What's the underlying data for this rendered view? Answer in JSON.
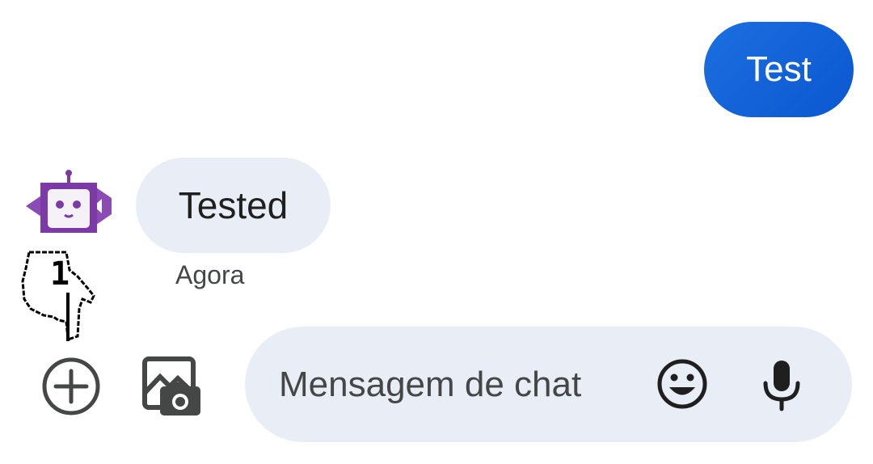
{
  "messages": {
    "sent": {
      "text": "Test"
    },
    "received": {
      "text": "Tested",
      "timestamp": "Agora"
    }
  },
  "cursor": {
    "label": "1"
  },
  "composer": {
    "placeholder": "Mensagem de chat"
  },
  "icons": {
    "add": "add-circle-icon",
    "media": "gallery-camera-icon",
    "emoji": "emoji-icon",
    "mic": "microphone-icon",
    "avatar": "robot-avatar"
  },
  "colors": {
    "sent_bubble": "#0b57d0",
    "received_bubble": "#e9eef6",
    "compose_bg": "#e9eef6",
    "avatar_purple": "#7b3aa6"
  }
}
